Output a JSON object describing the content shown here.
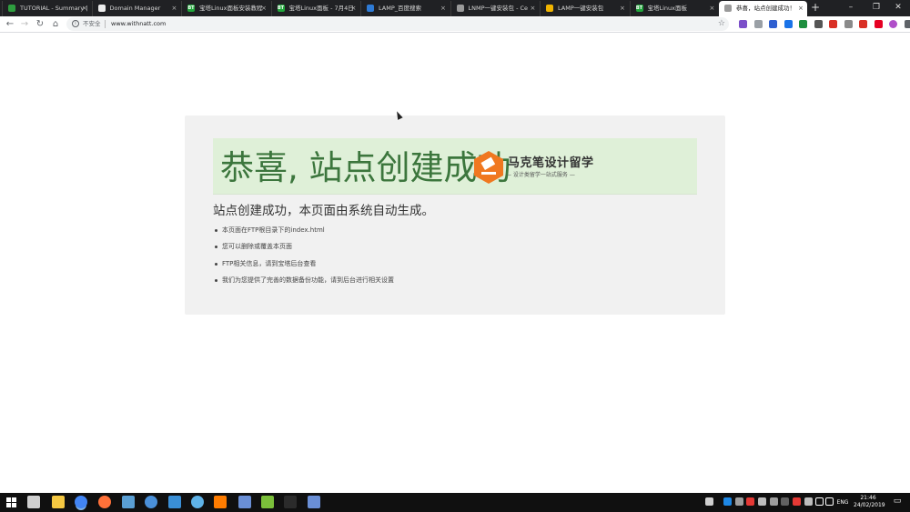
{
  "browser": {
    "tabs": [
      {
        "label": "TUTORIAL - Summary |",
        "favicon": "green-leaf-icon",
        "color": "#2e9e3f",
        "glyph": ""
      },
      {
        "label": "Domain Manager",
        "favicon": "hand-icon",
        "color": "#ececec",
        "glyph": ""
      },
      {
        "label": "宝塔Linux面板安装教程",
        "favicon": "bt-icon",
        "color": "#20a53a",
        "glyph": "BT"
      },
      {
        "label": "宝塔Linux面板 - 7月4日",
        "favicon": "bt-icon",
        "color": "#20a53a",
        "glyph": "BT"
      },
      {
        "label": "LAMP_百度搜索",
        "favicon": "baidu-icon",
        "color": "#2e7bd6",
        "glyph": ""
      },
      {
        "label": "LNMP一键安装包 - Ce",
        "favicon": "page-icon",
        "color": "#9a9a9a",
        "glyph": ""
      },
      {
        "label": "LAMP一键安装包",
        "favicon": "warning-icon",
        "color": "#f0b400",
        "glyph": ""
      },
      {
        "label": "宝塔Linux面板",
        "favicon": "bt-icon",
        "color": "#20a53a",
        "glyph": "BT"
      },
      {
        "label": "恭喜，站点创建成功！",
        "favicon": "page-icon",
        "color": "#9a9a9a",
        "glyph": ""
      }
    ],
    "tab_close": "×",
    "new_tab": "+",
    "window_controls": {
      "minimize": "–",
      "restore": "❐",
      "close": "✕"
    },
    "nav": {
      "back": "←",
      "forward": "→",
      "reload": "↻",
      "home": "⌂"
    },
    "omnibox": {
      "info": "i",
      "security": "不安全",
      "url": "www.withnatt.com",
      "star": "☆"
    },
    "extensions": [
      {
        "name": "ext-purple-icon",
        "color": "#7b4fc9"
      },
      {
        "name": "ext-grid-icon",
        "color": "#9aa0a6"
      },
      {
        "name": "ext-blue-ring-icon",
        "color": "#2f5fd0"
      },
      {
        "name": "ext-blue-icon",
        "color": "#1a73e8"
      },
      {
        "name": "ext-green-icon",
        "color": "#1e8e3e"
      },
      {
        "name": "ext-pen-icon",
        "color": "#555555"
      },
      {
        "name": "ext-pepper-icon",
        "color": "#d93025"
      },
      {
        "name": "ext-gray-icon",
        "color": "#8a8a8a"
      },
      {
        "name": "ext-red-icon",
        "color": "#d93025"
      },
      {
        "name": "ext-pinterest-icon",
        "color": "#e60023"
      },
      {
        "name": "profile-avatar-icon",
        "color": "#b04fc9"
      },
      {
        "name": "menu-icon",
        "color": "#5f6368"
      }
    ]
  },
  "page": {
    "title": "恭喜, 站点创建成功",
    "logo": {
      "brand": "马克笔设计留学",
      "slogan": "— 设计类留学一站式服务 —",
      "color": "#f07820"
    },
    "subtitle": "站点创建成功，本页面由系统自动生成。",
    "items": [
      "本页面在FTP根目录下的index.html",
      "您可以删除或覆盖本页面",
      "FTP相关信息，请到宝塔后台查看",
      "我们为您提供了完善的数据备份功能，请到后台进行相关设置"
    ]
  },
  "taskbar": {
    "apps": [
      {
        "name": "task-view-icon",
        "color": "#cfcfcf"
      },
      {
        "name": "file-explorer-icon",
        "color": "#f5c842"
      },
      {
        "name": "chrome-icon",
        "color": "#4285f4"
      },
      {
        "name": "firefox-icon",
        "color": "#ff7139"
      },
      {
        "name": "vscode-icon",
        "color": "#5a9fd4"
      },
      {
        "name": "app-blue-ring-icon",
        "color": "#4a90d9"
      },
      {
        "name": "app-3-icon",
        "color": "#3a8fd6"
      },
      {
        "name": "app-cyan-ring-icon",
        "color": "#5fb3e8"
      },
      {
        "name": "illustrator-icon",
        "color": "#ff7c00"
      },
      {
        "name": "network-app-icon",
        "color": "#6a8fd6"
      },
      {
        "name": "notepad-icon",
        "color": "#7bbf3a"
      },
      {
        "name": "terminal-icon",
        "color": "#2b2b2b"
      },
      {
        "name": "remote-app-icon",
        "color": "#6a8fd6"
      }
    ],
    "tray_icons": [
      {
        "name": "people-icon",
        "color": "#cfcfcf"
      },
      {
        "name": "tray-blue-icon",
        "color": "#1e88e5"
      },
      {
        "name": "tray-gray-icon",
        "color": "#9e9e9e"
      },
      {
        "name": "tray-red-icon",
        "color": "#e53935"
      },
      {
        "name": "tray-light-icon",
        "color": "#bdbdbd"
      },
      {
        "name": "tray-badge-icon",
        "color": "#9e9e9e"
      },
      {
        "name": "tray-dark-icon",
        "color": "#616161"
      },
      {
        "name": "tray-red-2-icon",
        "color": "#e53935"
      },
      {
        "name": "onedrive-icon",
        "color": "#bdbdbd"
      },
      {
        "name": "wifi-icon",
        "color": "#ffffff"
      },
      {
        "name": "volume-icon",
        "color": "#ffffff"
      }
    ],
    "language": "ENG",
    "time": "21:46",
    "date": "24/02/2019",
    "notification": "▭"
  }
}
